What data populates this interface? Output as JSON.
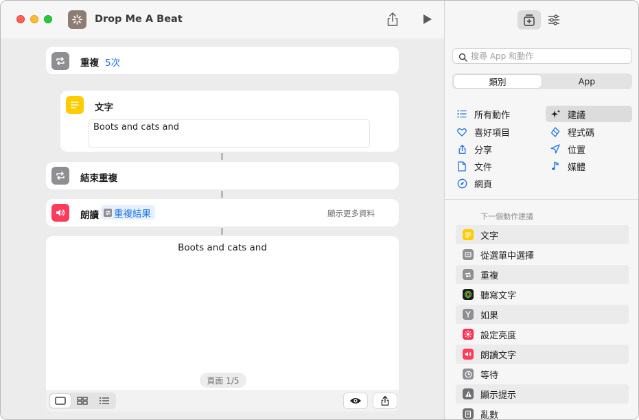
{
  "window": {
    "title": "Drop Me A Beat"
  },
  "colors": {
    "accent": "#1a73e8",
    "repeat_icon": "#8e8e93",
    "text_icon": "#ffcc00",
    "speak_icon": "#ff3b5c",
    "traffic_red": "#ff5f57",
    "traffic_yellow": "#febc2e",
    "traffic_green": "#28c840"
  },
  "editor": {
    "repeat": {
      "label": "重複",
      "count": "5次"
    },
    "text": {
      "label": "文字",
      "value": "Boots and cats and"
    },
    "end_repeat": {
      "label": "結束重複"
    },
    "speak": {
      "label": "朗讀",
      "variable": "重複結果",
      "show_more": "顯示更多資料"
    },
    "preview": {
      "text": "Boots and cats and",
      "page": "頁面 1/5"
    }
  },
  "sidebar": {
    "search_placeholder": "搜尋 App 和動作",
    "segments": [
      "類別",
      "App"
    ],
    "categories_left": [
      {
        "label": "所有動作",
        "icon": "list-icon"
      },
      {
        "label": "喜好項目",
        "icon": "heart-icon"
      },
      {
        "label": "分享",
        "icon": "share-icon"
      },
      {
        "label": "文件",
        "icon": "document-icon"
      },
      {
        "label": "網頁",
        "icon": "compass-icon"
      }
    ],
    "categories_right": [
      {
        "label": "建議",
        "icon": "sparkles-icon"
      },
      {
        "label": "程式碼",
        "icon": "code-icon"
      },
      {
        "label": "位置",
        "icon": "location-icon"
      },
      {
        "label": "媒體",
        "icon": "music-note-icon"
      }
    ],
    "next_header": "下一個動作建議",
    "suggestions": [
      {
        "label": "文字",
        "icon": "text-icon",
        "color": "#ffcc00"
      },
      {
        "label": "從選單中選擇",
        "icon": "menu-icon",
        "color": "#8e8e93"
      },
      {
        "label": "重複",
        "icon": "repeat-icon",
        "color": "#8e8e93"
      },
      {
        "label": "聽寫文字",
        "icon": "dictation-icon",
        "color": "#1c1c1e"
      },
      {
        "label": "如果",
        "icon": "if-icon",
        "color": "#8e8e93"
      },
      {
        "label": "設定亮度",
        "icon": "brightness-icon",
        "color": "#ff2d55"
      },
      {
        "label": "朗讀文字",
        "icon": "speaker-icon",
        "color": "#ff3b5c"
      },
      {
        "label": "等待",
        "icon": "clock-icon",
        "color": "#8e8e93"
      },
      {
        "label": "顯示提示",
        "icon": "alert-icon",
        "color": "#6e6e73"
      },
      {
        "label": "亂數",
        "icon": "dice-icon",
        "color": "#6e6e73"
      }
    ]
  }
}
